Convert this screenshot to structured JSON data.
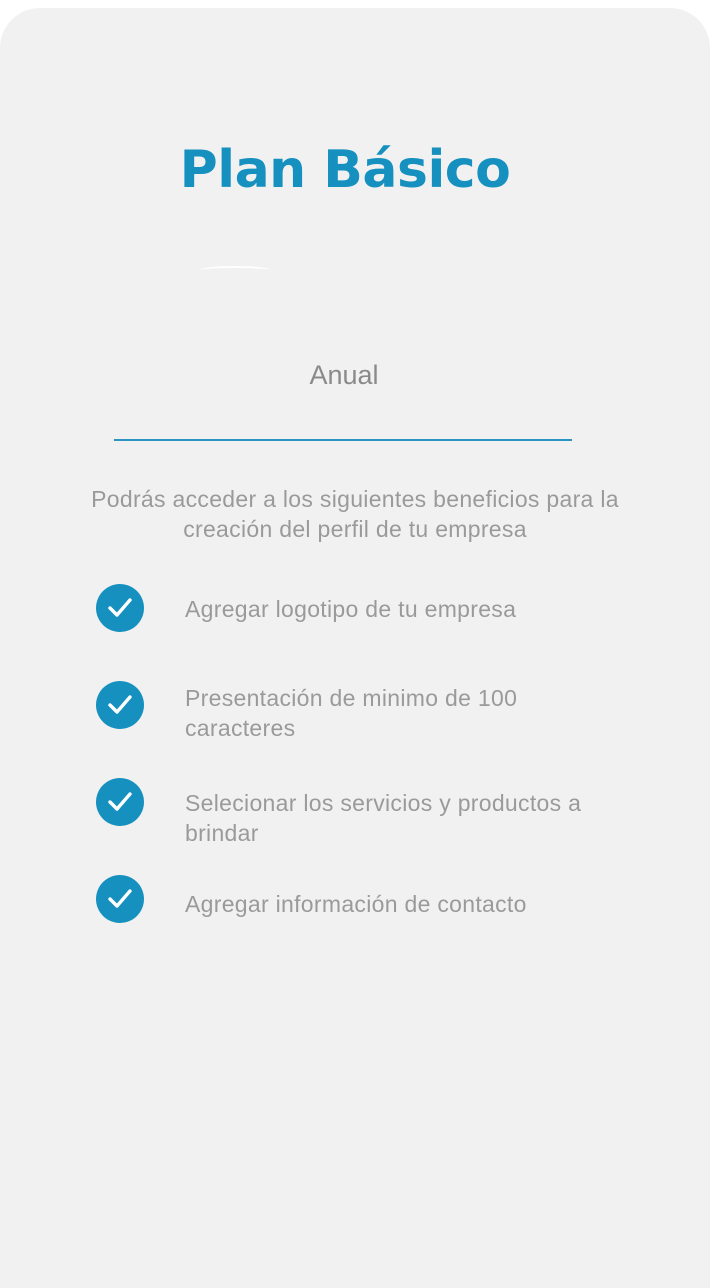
{
  "plan": {
    "title": "Plan Básico",
    "period": "Anual"
  },
  "description": "Podrás acceder a los siguientes beneficios para la creación del perfil de tu empresa",
  "benefits": [
    {
      "label": "Agregar logotipo de tu empresa",
      "icon": "check-circle-icon"
    },
    {
      "label": "Presentación de minimo de 100 caracteres",
      "icon": "check-circle-icon"
    },
    {
      "label": "Selecionar los servicios y productos a brindar",
      "icon": "check-circle-icon"
    },
    {
      "label": "Agregar información de contacto",
      "icon": "check-circle-icon"
    }
  ],
  "colors": {
    "accent": "#1590bf",
    "background": "#f1f1f2",
    "text_muted": "#9a9a9a"
  }
}
